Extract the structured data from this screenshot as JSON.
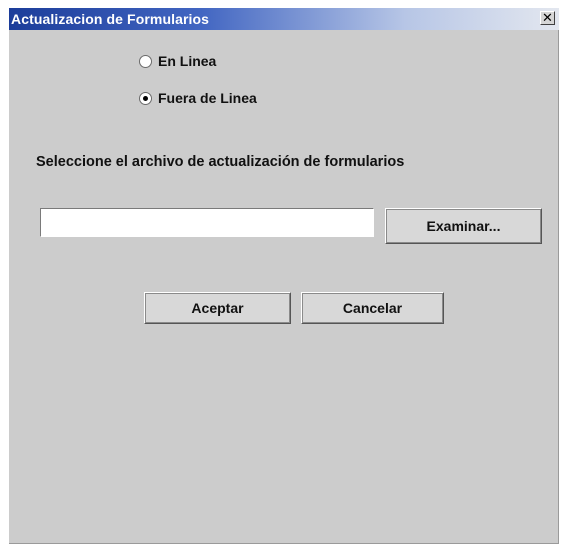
{
  "window": {
    "title": "Actualizacion de Formularios",
    "close_symbol": "✕"
  },
  "mode": {
    "options": [
      {
        "label": "En Linea",
        "selected": false
      },
      {
        "label": "Fuera de Linea",
        "selected": true
      }
    ]
  },
  "file_section": {
    "instruction": "Seleccione el archivo de actualización de formularios",
    "file_path": "",
    "browse_label": "Examinar..."
  },
  "actions": {
    "accept_label": "Aceptar",
    "cancel_label": "Cancelar"
  },
  "colors": {
    "titlebar_start": "#1c3d9a",
    "titlebar_end": "#e3e7ef",
    "dialog_background": "#cccccc"
  }
}
